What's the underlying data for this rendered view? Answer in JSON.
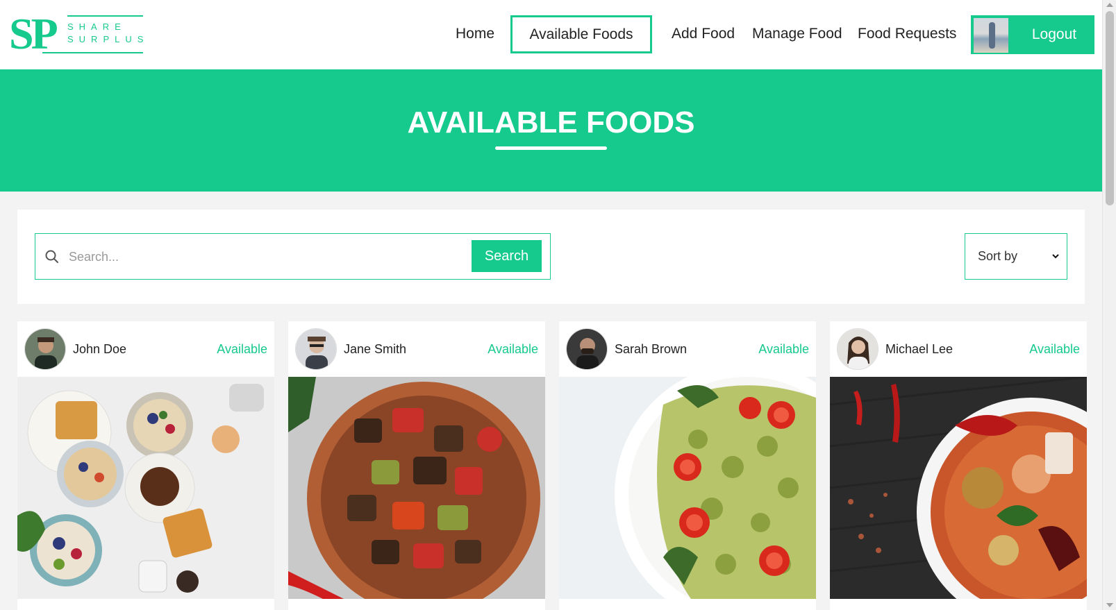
{
  "brand": {
    "initials": "SP",
    "word1": "SHARE",
    "word2": "SURPLUS"
  },
  "nav": {
    "items": [
      "Home",
      "Available Foods",
      "Add Food",
      "Manage Food",
      "Food Requests"
    ],
    "logout_label": "Logout"
  },
  "hero": {
    "title": "AVAILABLE FOODS"
  },
  "search": {
    "placeholder": "Search...",
    "button_label": "Search"
  },
  "sort": {
    "selected": "Sort by"
  },
  "cards": [
    {
      "donor": "John Doe",
      "status": "Available",
      "image": "breakfast-spread"
    },
    {
      "donor": "Jane Smith",
      "status": "Available",
      "image": "roasted-vegetables"
    },
    {
      "donor": "Sarah Brown",
      "status": "Available",
      "image": "pesto-pasta"
    },
    {
      "donor": "Michael Lee",
      "status": "Available",
      "image": "curry-bowl"
    }
  ],
  "colors": {
    "accent": "#16c98d"
  }
}
